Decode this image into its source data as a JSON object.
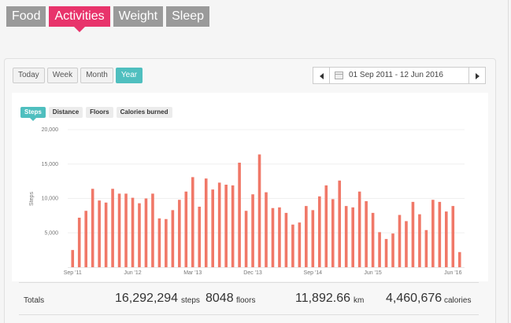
{
  "tabs": [
    "Food",
    "Activities",
    "Weight",
    "Sleep"
  ],
  "active_tab": 1,
  "range_buttons": [
    "Today",
    "Week",
    "Month",
    "Year"
  ],
  "active_range": 3,
  "date_range": "01 Sep 2011 - 12 Jun 2016",
  "metric_tabs": [
    "Steps",
    "Distance",
    "Floors",
    "Calories burned"
  ],
  "active_metric": 0,
  "colors": {
    "active_tab": "#e8336b",
    "accent": "#4fbfbf",
    "bar": "#f07868"
  },
  "totals": {
    "label": "Totals",
    "steps_value": "16,292,294",
    "steps_unit": "steps",
    "floors_value": "8048",
    "floors_unit": "floors",
    "distance_value": "11,892.66",
    "distance_unit": "km",
    "calories_value": "4,460,676",
    "calories_unit": "calories"
  },
  "chart_data": {
    "type": "bar",
    "ylabel": "Steps",
    "ylim": [
      0,
      20000
    ],
    "yticks": [
      5000,
      10000,
      15000,
      20000
    ],
    "ytick_labels": [
      "5,000",
      "10,000",
      "15,000",
      "20,000"
    ],
    "x_tick_labels": [
      {
        "label": "Sep '11",
        "index": 0
      },
      {
        "label": "Jun '12",
        "index": 9
      },
      {
        "label": "Mar '13",
        "index": 18
      },
      {
        "label": "Dec '13",
        "index": 27
      },
      {
        "label": "Sep '14",
        "index": 36
      },
      {
        "label": "Jun '15",
        "index": 45
      },
      {
        "label": "Jun '16",
        "index": 57
      }
    ],
    "values": [
      2500,
      7200,
      8200,
      11400,
      9700,
      9400,
      11400,
      10700,
      10700,
      10100,
      9300,
      10000,
      10700,
      7100,
      7000,
      8300,
      9800,
      11000,
      13100,
      8800,
      12900,
      11300,
      12300,
      12000,
      11900,
      15200,
      8200,
      10600,
      16400,
      10900,
      8600,
      8700,
      7900,
      6200,
      6500,
      8900,
      8300,
      10300,
      11900,
      9900,
      12600,
      8900,
      8700,
      11000,
      9600,
      7900,
      5100,
      4100,
      4900,
      7600,
      6700,
      9500,
      7700,
      5400,
      9800,
      9500,
      8100,
      8900,
      2200
    ]
  }
}
